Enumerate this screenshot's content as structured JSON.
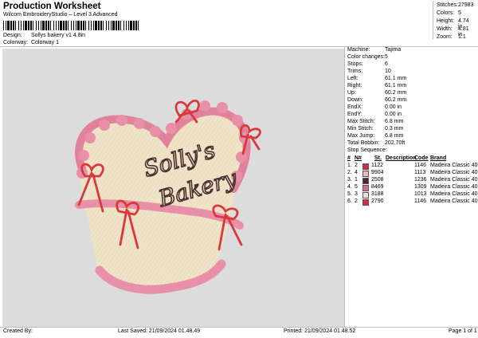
{
  "header": {
    "title": "Production Worksheet",
    "subtitle": "Wilcom EmbroideryStudio – Level 3 Advanced",
    "design_label": "Design:",
    "design_value": "Sollys bakery v1 4.8in",
    "colorway_label": "Colorway:",
    "colorway_value": "Colorway 1"
  },
  "top_stats": [
    {
      "label": "Stitches:",
      "value": "27983"
    },
    {
      "label": "Colors:",
      "value": "5"
    },
    {
      "label": "Height:",
      "value": "4.74 in"
    },
    {
      "label": "Width:",
      "value": "4.81 in"
    },
    {
      "label": "Zoom:",
      "value": "1:1"
    }
  ],
  "machine_info": [
    {
      "label": "Machine:",
      "value": "Tajima"
    },
    {
      "label": "Color changes:",
      "value": "5"
    },
    {
      "label": "Stops:",
      "value": "6"
    },
    {
      "label": "Trims:",
      "value": "10"
    },
    {
      "label": "Left:",
      "value": "61.1 mm"
    },
    {
      "label": "Right:",
      "value": "61.1 mm"
    },
    {
      "label": "Up:",
      "value": "60.2 mm"
    },
    {
      "label": "Down:",
      "value": "60.2 mm"
    },
    {
      "label": "EndX:",
      "value": "0.00 in"
    },
    {
      "label": "EndY:",
      "value": "0.00 in"
    },
    {
      "label": "Max Stitch:",
      "value": "6.8 mm"
    },
    {
      "label": "Min Stitch:",
      "value": "0.3 mm"
    },
    {
      "label": "Max Jump:",
      "value": "6.8 mm"
    },
    {
      "label": "Total Bobbin:",
      "value": "202.70ft"
    }
  ],
  "stop_sequence": {
    "title": "Stop Sequence:",
    "columns": [
      "#",
      "N#",
      "St.",
      "Description",
      "Code",
      "Brand"
    ],
    "rows": [
      {
        "num": "1.",
        "n": "2",
        "color": "#d42b3a",
        "st": "1122",
        "code": "1146",
        "brand": "Madeira Classic 40"
      },
      {
        "num": "2.",
        "n": "4",
        "color": "#f2b8c0",
        "st": "9904",
        "code": "1113",
        "brand": "Madeira Classic 40"
      },
      {
        "num": "3.",
        "n": "1",
        "color": "#4a2a2a",
        "st": "2508",
        "code": "1236",
        "brand": "Madeira Classic 40"
      },
      {
        "num": "4.",
        "n": "5",
        "color": "#d86a8c",
        "st": "8469",
        "code": "1309",
        "brand": "Madeira Classic 40"
      },
      {
        "num": "5.",
        "n": "3",
        "color": "#f2d8d0",
        "st": "3188",
        "code": "1013",
        "brand": "Madeira Classic 40"
      },
      {
        "num": "6.",
        "n": "2",
        "color": "#d42b3a",
        "st": "2790",
        "code": "1146",
        "brand": "Madeira Classic 40"
      }
    ]
  },
  "design": {
    "line1": "Solly's",
    "line2": "Bakery",
    "colors": {
      "fill": "#efe3c8",
      "ruffle": "#e0829c",
      "ribbon": "#d83a3c",
      "text": "#4a3030",
      "background": "#dcdcdc"
    }
  },
  "footer": {
    "created_by": "Created By:",
    "last_saved": "Last Saved: 21/09/2024 01.48.49",
    "printed": "Printed: 21/09/2024 01.48.52",
    "page": "Page 1 of 1"
  }
}
